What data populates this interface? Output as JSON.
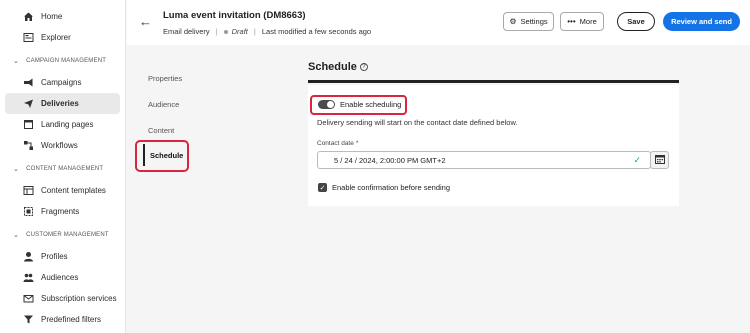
{
  "nav": {
    "top_items": [
      {
        "label": "Home",
        "icon": "home-icon"
      },
      {
        "label": "Explorer",
        "icon": "explorer-icon"
      }
    ],
    "sections": [
      {
        "title": "CAMPAIGN MANAGEMENT",
        "items": [
          {
            "label": "Campaigns",
            "icon": "megaphone-icon"
          },
          {
            "label": "Deliveries",
            "icon": "send-icon",
            "active": true
          },
          {
            "label": "Landing pages",
            "icon": "page-icon"
          },
          {
            "label": "Workflows",
            "icon": "workflow-icon"
          }
        ]
      },
      {
        "title": "CONTENT MANAGEMENT",
        "items": [
          {
            "label": "Content templates",
            "icon": "template-icon"
          },
          {
            "label": "Fragments",
            "icon": "fragment-icon"
          }
        ]
      },
      {
        "title": "CUSTOMER MANAGEMENT",
        "items": [
          {
            "label": "Profiles",
            "icon": "user-icon"
          },
          {
            "label": "Audiences",
            "icon": "audience-icon"
          },
          {
            "label": "Subscription services",
            "icon": "subscription-icon"
          },
          {
            "label": "Predefined filters",
            "icon": "filter-icon"
          }
        ]
      }
    ]
  },
  "header": {
    "title": "Luma event invitation (DM8663)",
    "type": "Email delivery",
    "status": "Draft",
    "modified": "Last modified a few seconds ago",
    "settings_label": "Settings",
    "more_label": "More",
    "save_label": "Save",
    "review_label": "Review and send"
  },
  "subnav": {
    "items": [
      "Properties",
      "Audience",
      "Content"
    ],
    "active": "Schedule"
  },
  "schedule": {
    "title": "Schedule",
    "toggle_label": "Enable scheduling",
    "toggle_on": true,
    "help_text": "Delivery sending will start on the contact date defined below.",
    "date_label": "Contact date",
    "required_mark": "*",
    "date_value": "5 / 24 / 2024,   2:00:00  PM  GMT+2",
    "confirm_label": "Enable confirmation before sending",
    "confirm_checked": true
  },
  "colors": {
    "accent": "#1473e6",
    "highlight": "#d7263d",
    "valid": "#2d9d78"
  }
}
